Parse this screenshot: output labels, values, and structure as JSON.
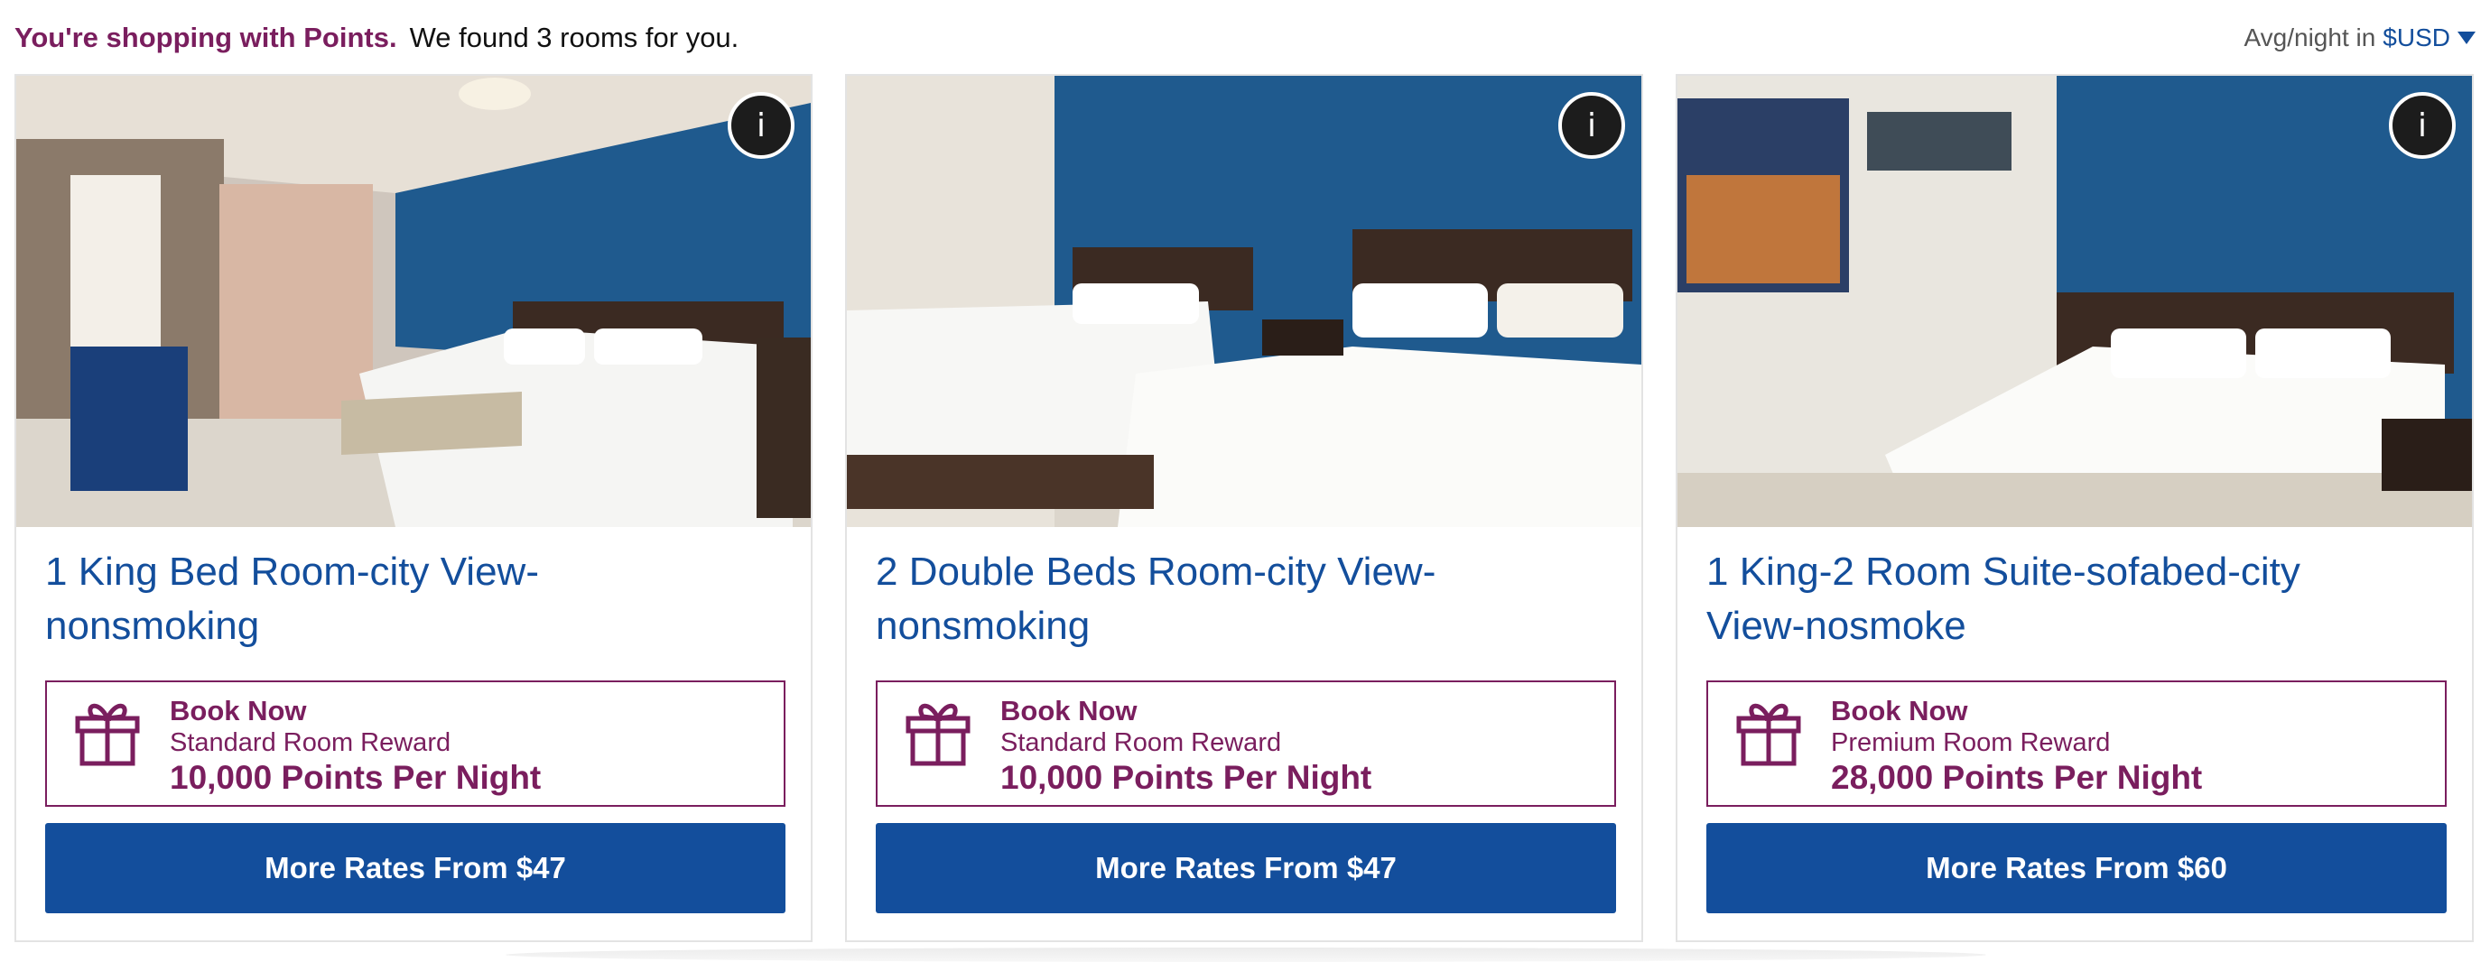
{
  "header": {
    "points_label": "You're shopping with Points.",
    "results_text": "We found 3 rooms for you.",
    "avg_label": "Avg/night in",
    "currency": "$USD"
  },
  "rooms": [
    {
      "title_line1": "1 King Bed Room-city View-",
      "title_line2": "nonsmoking",
      "info_label": "i",
      "book_now": "Book Now",
      "reward_type": "Standard Room Reward",
      "points": "10,000 Points Per Night",
      "rates_button": "More Rates From $47"
    },
    {
      "title_line1": "2 Double Beds Room-city View-",
      "title_line2": "nonsmoking",
      "info_label": "i",
      "book_now": "Book Now",
      "reward_type": "Standard Room Reward",
      "points": "10,000 Points Per Night",
      "rates_button": "More Rates From $47"
    },
    {
      "title_line1": "1 King-2 Room Suite-sofabed-city",
      "title_line2": "View-nosmoke",
      "info_label": "i",
      "book_now": "Book Now",
      "reward_type": "Premium Room Reward",
      "points": "28,000 Points Per Night",
      "rates_button": "More Rates From $60"
    }
  ],
  "icons": {
    "info": "info-icon",
    "gift": "gift-icon",
    "currency_caret": "caret-down-icon"
  },
  "colors": {
    "brand_purple": "#7a1e5e",
    "brand_blue": "#134e9c",
    "wall_blue": "#1f5a8e"
  }
}
